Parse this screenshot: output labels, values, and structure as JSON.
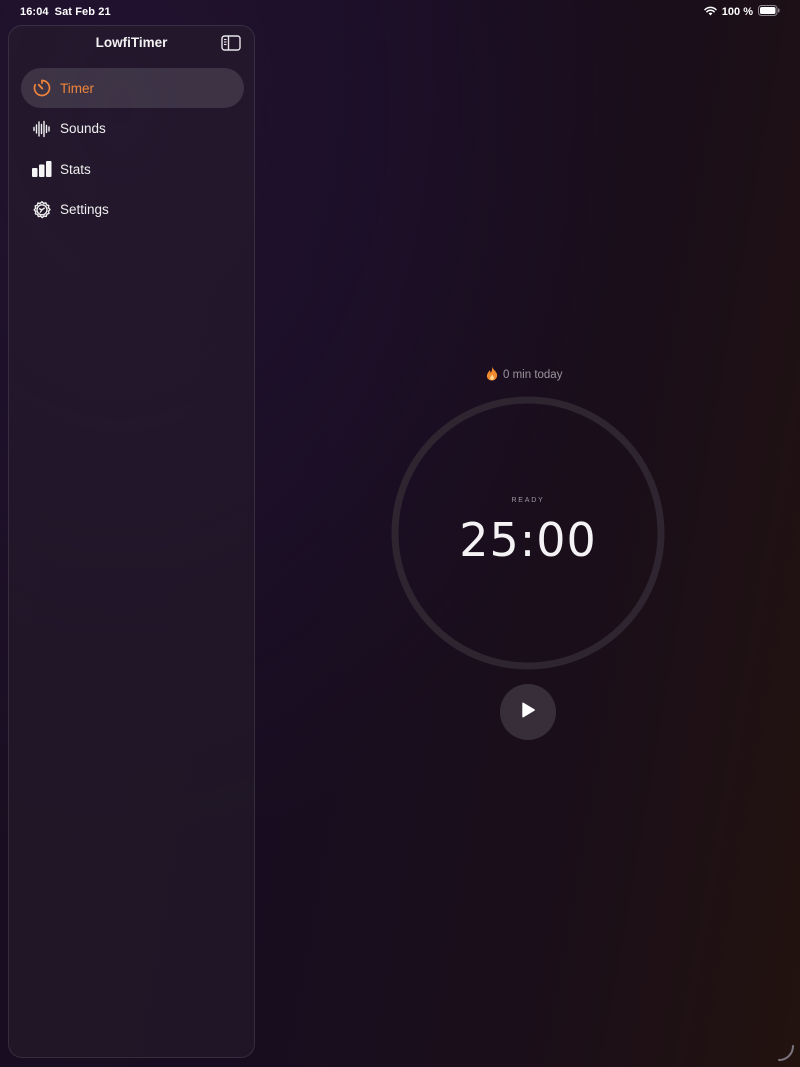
{
  "status_bar": {
    "time": "16:04",
    "date": "Sat Feb 21",
    "battery_text": "100 %",
    "wifi_icon": "wifi-icon",
    "battery_icon": "battery-full-icon"
  },
  "sidebar": {
    "title": "LowfiTimer",
    "toggle_icon": "sidebar-toggle-icon",
    "items": [
      {
        "label": "Timer",
        "icon": "timer-icon",
        "active": true
      },
      {
        "label": "Sounds",
        "icon": "waveform-icon",
        "active": false
      },
      {
        "label": "Stats",
        "icon": "bar-chart-icon",
        "active": false
      },
      {
        "label": "Settings",
        "icon": "gear-icon",
        "active": false
      }
    ]
  },
  "timer": {
    "today_text": "0 min today",
    "today_icon": "flame-icon",
    "state_label": "READY",
    "time": "25:00",
    "progress": 0,
    "play_icon": "play-icon"
  },
  "colors": {
    "accent": "#f0853a",
    "background": "#1a0f22",
    "ring_track": "#2e2530"
  }
}
